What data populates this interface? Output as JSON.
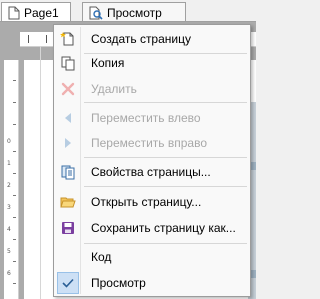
{
  "tabs": [
    {
      "label": "Page1",
      "icon": "page-icon"
    },
    {
      "label": "Просмотр",
      "icon": "magnifier-icon"
    }
  ],
  "ruler": {
    "vertical_numbers": [
      "0",
      "1",
      "2",
      "3",
      "4",
      "5",
      "6"
    ]
  },
  "context_menu": {
    "items": [
      {
        "label": "Создать страницу",
        "icon": "new-page-icon",
        "enabled": true
      },
      {
        "label": "Копия",
        "icon": "copy-icon",
        "enabled": true
      },
      {
        "label": "Удалить",
        "icon": "delete-x-icon",
        "enabled": false
      },
      {
        "label": "Переместить влево",
        "icon": "arrow-left-icon",
        "enabled": false
      },
      {
        "label": "Переместить вправо",
        "icon": "arrow-right-icon",
        "enabled": false
      },
      {
        "label": "Свойства страницы...",
        "icon": "page-properties-icon",
        "enabled": true
      },
      {
        "label": "Открыть страницу...",
        "icon": "open-folder-icon",
        "enabled": true
      },
      {
        "label": "Сохранить страницу как...",
        "icon": "floppy-disk-icon",
        "enabled": true
      },
      {
        "label": "Код",
        "icon": "",
        "enabled": true,
        "checked": false
      },
      {
        "label": "Просмотр",
        "icon": "checkmark-icon",
        "enabled": true,
        "checked": true
      }
    ]
  },
  "colors": {
    "menu_background": "#f9f9f9",
    "disabled_text": "#a8a8a8",
    "checked_highlight": "#cde0f5",
    "save_icon": "#7b3fa0",
    "folder_icon": "#e8b03a"
  }
}
